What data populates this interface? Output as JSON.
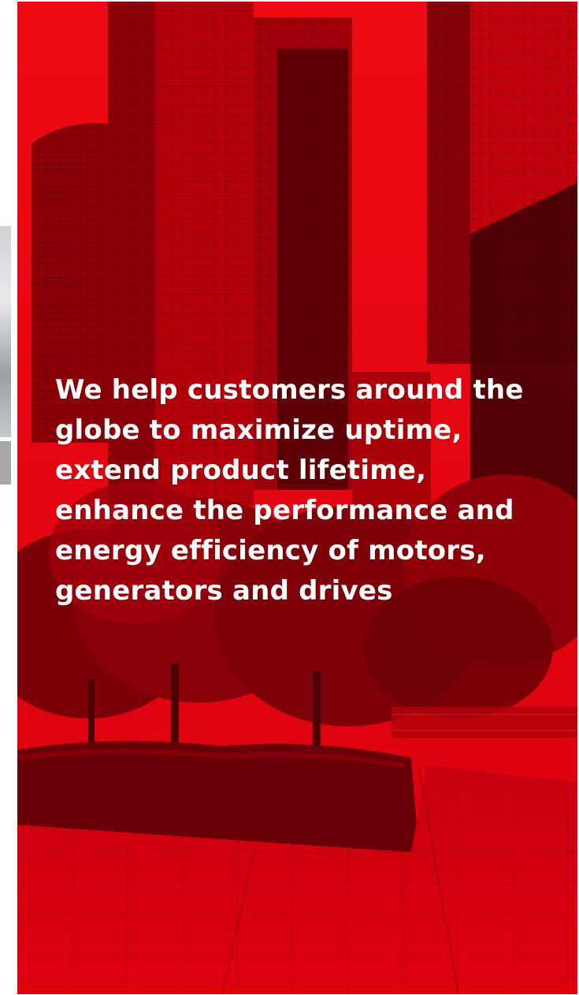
{
  "hero": {
    "tagline": "We help customers around the globe to maximize uptime, extend product lifetime, enhance the performance and energy efficiency of motors, generators and drives",
    "tint_color": "#e6000e"
  },
  "left_edge": {
    "photo_sliver_color": "#c9cdd0",
    "gray_block_color": "#a8a8a8"
  }
}
